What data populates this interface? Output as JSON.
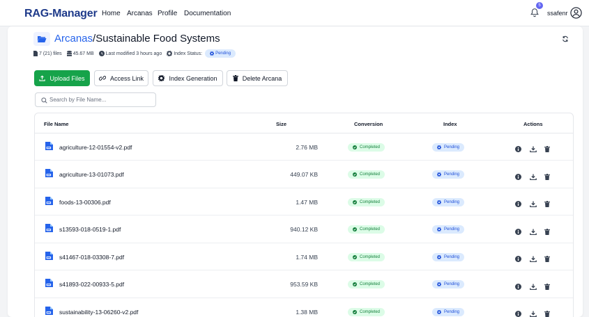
{
  "nav": {
    "brand": "RAG-Manager",
    "links": [
      "Home",
      "Arcanas",
      "Profile",
      "Documentation"
    ],
    "notifications": "5",
    "username": "ssafenr"
  },
  "header": {
    "crumb": "Arcanas",
    "separator": "/",
    "title": "Sustainable Food Systems",
    "meta": {
      "files": "7 (21) files",
      "size": "45.67 MB",
      "modified": "Last modified 3 hours ago",
      "index_label": "Index Status:",
      "index_status": "Pending"
    }
  },
  "toolbar": {
    "upload": "Upload Files",
    "access": "Access Link",
    "index": "Index Generation",
    "delete": "Delete Arcana"
  },
  "search": {
    "placeholder": "Search by File Name..."
  },
  "table": {
    "columns": [
      "File Name",
      "Size",
      "Conversion",
      "Index",
      "Actions"
    ],
    "rows": [
      {
        "name": "agriculture-12-01554-v2.pdf",
        "size": "2.76 MB",
        "conversion": "Completed",
        "index": "Pending"
      },
      {
        "name": "agriculture-13-01073.pdf",
        "size": "449.07 KB",
        "conversion": "Completed",
        "index": "Pending"
      },
      {
        "name": "foods-13-00306.pdf",
        "size": "1.47 MB",
        "conversion": "Completed",
        "index": "Pending"
      },
      {
        "name": "s13593-018-0519-1.pdf",
        "size": "940.12 KB",
        "conversion": "Completed",
        "index": "Pending"
      },
      {
        "name": "s41467-018-03308-7.pdf",
        "size": "1.74 MB",
        "conversion": "Completed",
        "index": "Pending"
      },
      {
        "name": "s41893-022-00933-5.pdf",
        "size": "953.59 KB",
        "conversion": "Completed",
        "index": "Pending"
      },
      {
        "name": "sustainability-13-06260-v2.pdf",
        "size": "1.38 MB",
        "conversion": "Completed",
        "index": "Pending"
      }
    ]
  },
  "colors": {
    "brand": "#1e3a8a",
    "link": "#2563eb",
    "primary_button": "#16a34a",
    "completed_bg": "#dcfce7",
    "completed_fg": "#15803d",
    "pending_bg": "#dbeafe",
    "pending_fg": "#1d4ed8",
    "file_icon": "#2563eb"
  },
  "icons": {
    "notifications": "bell-icon",
    "user": "user-circle-icon",
    "folder": "folder-open-icon",
    "refresh": "refresh-icon",
    "files": "file-icon",
    "size": "database-icon",
    "modified": "clock-icon",
    "index": "gear-icon",
    "upload": "upload-icon",
    "access": "link-icon",
    "index_generation": "gear-icon",
    "delete": "trash-icon",
    "search": "search-icon",
    "pdf": "pdf-file-icon",
    "info": "info-icon",
    "download": "download-icon",
    "row_delete": "trash-icon"
  }
}
